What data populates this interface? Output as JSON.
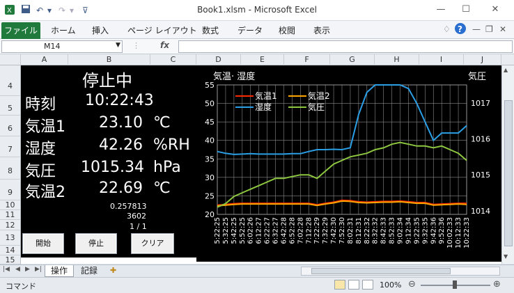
{
  "window": {
    "title": "Book1.xlsm  -  Microsoft Excel",
    "minimize": "—",
    "restore": "☐",
    "close": "✕"
  },
  "ribbon": {
    "file": "ファイル",
    "tabs": [
      "ホーム",
      "挿入",
      "ページ レイアウト",
      "数式",
      "データ",
      "校閲",
      "表示"
    ]
  },
  "formula_bar": {
    "name_box": "M14",
    "fx": "fx",
    "value": ""
  },
  "columns": [
    "A",
    "B",
    "C",
    "D",
    "E",
    "F",
    "G",
    "H",
    "I",
    "J"
  ],
  "rows": [
    "4",
    "5",
    "6",
    "7",
    "8",
    "9",
    "10",
    "11",
    "12",
    "13",
    "14",
    "15"
  ],
  "panel": {
    "status": "停止中",
    "time_label": "時刻",
    "time_value": "10:22:43",
    "temp1_label": "気温1",
    "temp1_value": "23.10",
    "temp1_unit": "℃",
    "humidity_label": "湿度",
    "humidity_value": "42.26",
    "humidity_unit": "%RH",
    "pressure_label": "気圧",
    "pressure_value": "1015.34",
    "pressure_unit": "hPa",
    "temp2_label": "気温2",
    "temp2_value": "22.69",
    "temp2_unit": "℃",
    "val_a": "0.257813",
    "val_b": "3602",
    "page": "1 / 1",
    "btn_start": "開始",
    "btn_stop": "停止",
    "btn_clear": "クリア"
  },
  "sheet_tabs": [
    "操作",
    "記録"
  ],
  "status_bar": {
    "mode": "コマンド",
    "zoom": "100%"
  },
  "chart_data": {
    "type": "line",
    "ylabel": "気温· 湿度",
    "y2label": "気圧",
    "ylim": [
      20,
      55
    ],
    "yticks": [
      20,
      25,
      30,
      35,
      40,
      45,
      50,
      55
    ],
    "y2lim": [
      1013.9,
      1017.5
    ],
    "y2ticks": [
      1014,
      1015,
      1016,
      1017
    ],
    "legend_position": "top-left",
    "categories": [
      "5:22:25",
      "5:32:25",
      "5:42:25",
      "5:52:25",
      "6:02:26",
      "6:12:27",
      "6:22:27",
      "6:32:27",
      "6:42:28",
      "6:52:28",
      "7:02:28",
      "7:12:28",
      "7:22:29",
      "7:32:29",
      "7:42:30",
      "7:52:30",
      "8:02:31",
      "8:12:31",
      "8:22:32",
      "8:32:32",
      "8:42:33",
      "8:52:33",
      "9:02:34",
      "9:12:34",
      "9:22:35",
      "9:32:35",
      "9:42:36",
      "9:52:36",
      "10:02:33",
      "10:12:33",
      "10:22:33"
    ],
    "series": [
      {
        "name": "気温1",
        "color": "#ff2a00",
        "axis": "left",
        "values": [
          22.5,
          22.7,
          22.9,
          23.0,
          23.0,
          23.0,
          23.0,
          23.0,
          23.0,
          23.0,
          23.0,
          23.0,
          22.6,
          23.0,
          23.3,
          23.8,
          23.7,
          23.4,
          23.3,
          23.4,
          23.5,
          23.5,
          23.6,
          23.4,
          23.2,
          23.2,
          22.7,
          22.8,
          22.9,
          23.0,
          23.0
        ]
      },
      {
        "name": "気温2",
        "color": "#ffa500",
        "axis": "left",
        "values": [
          22.3,
          22.5,
          22.7,
          22.8,
          22.8,
          22.8,
          22.8,
          22.8,
          22.8,
          22.8,
          22.8,
          22.8,
          22.4,
          22.8,
          23.1,
          23.6,
          23.5,
          23.2,
          23.1,
          23.2,
          23.3,
          23.3,
          23.4,
          23.2,
          23.0,
          23.0,
          22.5,
          22.6,
          22.7,
          22.8,
          22.7
        ]
      },
      {
        "name": "湿度",
        "color": "#2b9fe6",
        "axis": "left",
        "values": [
          37,
          36.5,
          36.2,
          36.3,
          36.4,
          36.3,
          36.3,
          36.3,
          36.3,
          36.4,
          36.4,
          37.0,
          37.5,
          37.5,
          37.6,
          37.5,
          38,
          47,
          53,
          55,
          55,
          55,
          55,
          54,
          50,
          45,
          40,
          42,
          42,
          42,
          44
        ]
      },
      {
        "name": "気圧",
        "color": "#8dc63f",
        "axis": "right",
        "values": [
          1014.1,
          1014.2,
          1014.4,
          1014.5,
          1014.6,
          1014.7,
          1014.8,
          1014.9,
          1014.9,
          1014.95,
          1015.0,
          1015.0,
          1014.9,
          1015.1,
          1015.3,
          1015.4,
          1015.5,
          1015.55,
          1015.6,
          1015.7,
          1015.75,
          1015.85,
          1015.9,
          1015.85,
          1015.8,
          1015.8,
          1015.75,
          1015.8,
          1015.7,
          1015.6,
          1015.4
        ]
      }
    ]
  }
}
